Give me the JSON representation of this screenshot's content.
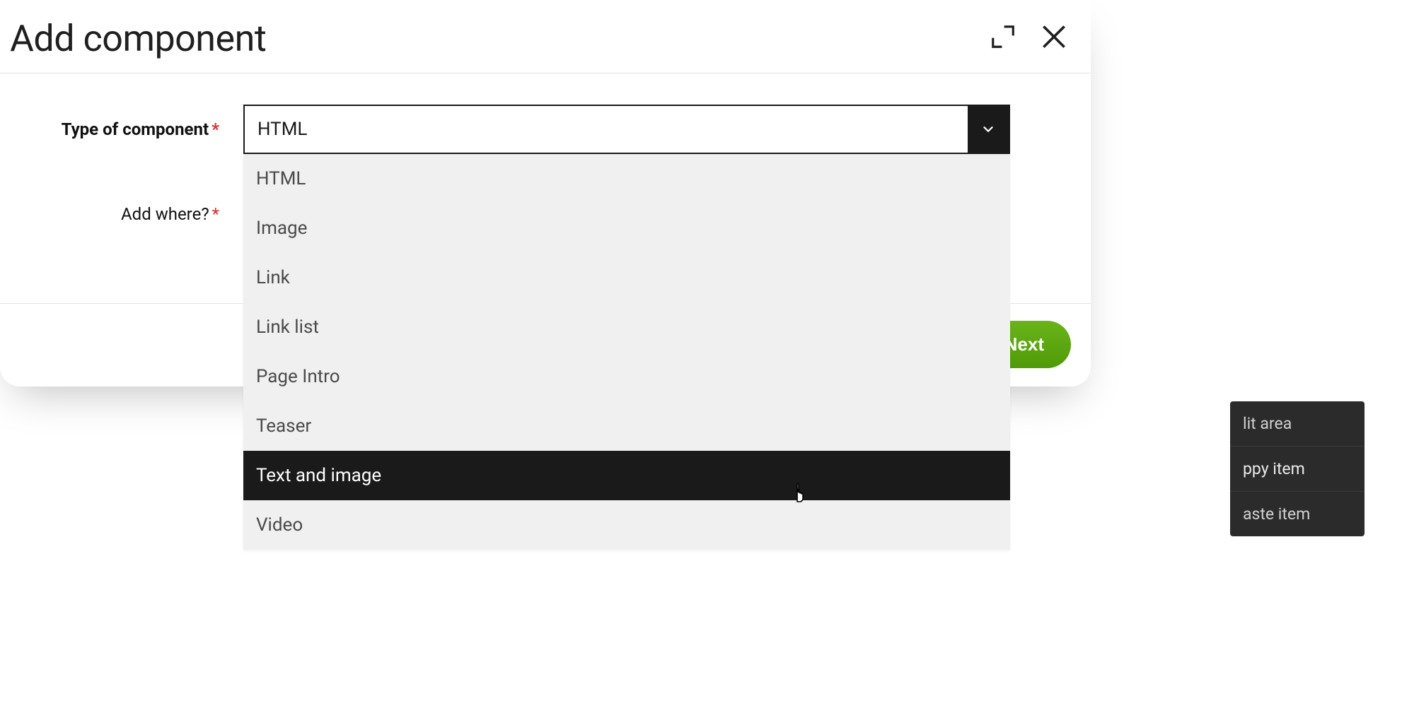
{
  "modal": {
    "title": "Add component",
    "form": {
      "type_label": "Type of component",
      "where_label": "Add where?"
    },
    "select": {
      "value": "HTML",
      "options": [
        "HTML",
        "Image",
        "Link",
        "Link list",
        "Page Intro",
        "Teaser",
        "Text and image",
        "Video"
      ],
      "highlight_index": 6
    },
    "next_label": "Next"
  },
  "context_menu": {
    "items": [
      {
        "label": "lit area"
      },
      {
        "label": "ppy item"
      },
      {
        "label": "aste item"
      }
    ]
  }
}
